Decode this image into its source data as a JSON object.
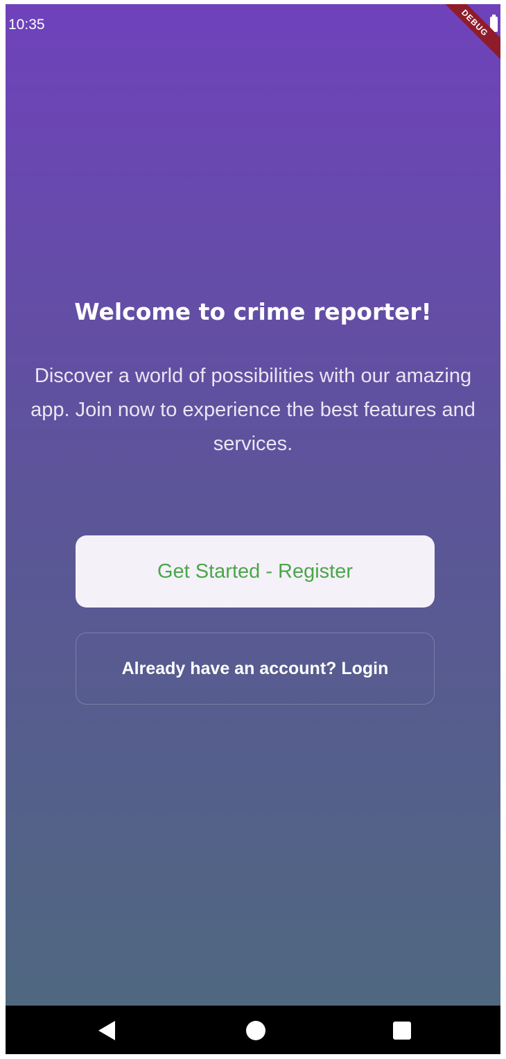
{
  "status_bar": {
    "time": "10:35",
    "icons": [
      "battery-icon"
    ]
  },
  "debug_banner": "DEBUG",
  "welcome": {
    "title": "Welcome to crime reporter!",
    "description": "Discover a world of possibilities with our amazing app. Join now to experience the best features and services."
  },
  "buttons": {
    "register_label": "Get Started - Register",
    "login_label": "Already have an account? Login"
  },
  "nav_bar": {
    "icons": [
      "back-icon",
      "home-icon",
      "recents-icon"
    ]
  },
  "colors": {
    "gradient_top": "#6f42bb",
    "gradient_bottom": "#4f6880",
    "register_text": "#4aa64b",
    "register_bg": "#f5f1f8",
    "debug_ribbon": "#8e1c2c"
  }
}
